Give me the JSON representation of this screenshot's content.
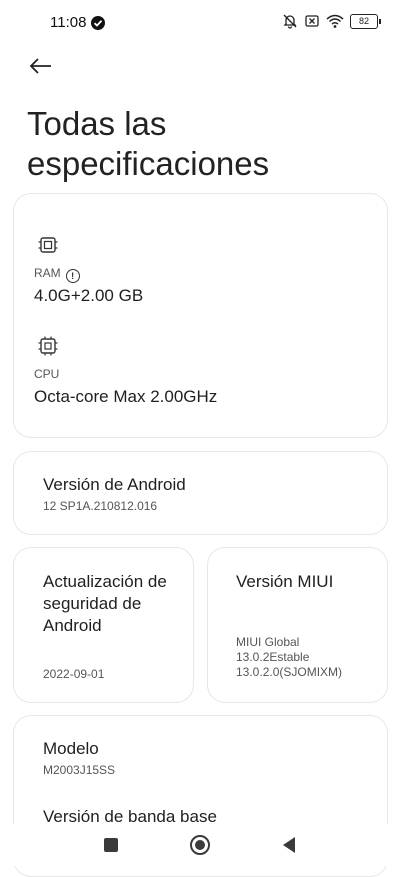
{
  "status_bar": {
    "time": "11:08",
    "battery": "82"
  },
  "page": {
    "title": "Todas las especificaciones"
  },
  "specs_card": {
    "ram_label": "RAM",
    "ram_value": "4.0G+2.00 GB",
    "cpu_label": "CPU",
    "cpu_value": "Octa-core Max 2.00GHz"
  },
  "android_card": {
    "title": "Versión de Android",
    "value": "12 SP1A.210812.016"
  },
  "security_card": {
    "title": "Actualización de seguridad de Android",
    "value": "2022-09-01"
  },
  "miui_card": {
    "title": "Versión MIUI",
    "value_line1": "MIUI Global",
    "value_line2": "13.0.2Estable",
    "value_line3": "13.0.2.0(SJOMIXM)"
  },
  "model_card": {
    "title": "Modelo",
    "value": "M2003J15SS",
    "next_title": "Versión de banda base"
  }
}
